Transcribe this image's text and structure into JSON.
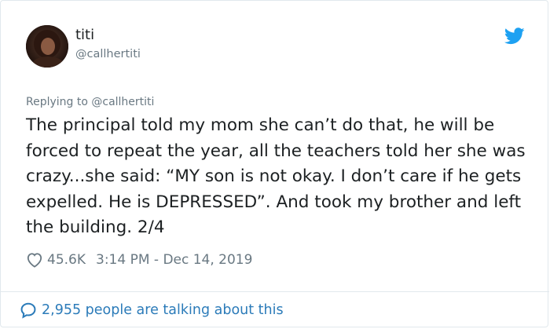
{
  "author": {
    "display_name": "titi",
    "handle": "@callhertiti"
  },
  "reply": {
    "text": "Replying to @callhertiti"
  },
  "tweet": {
    "text": "The principal told my mom she can’t do that, he will be forced to repeat the year, all the teachers told her she was crazy...she said: “MY son is not okay. I don’t care if he gets expelled. He is DEPRESSED”. And took my brother and left the building. 2/4"
  },
  "stats": {
    "likes": "45.6K",
    "timestamp": "3:14 PM - Dec 14, 2019"
  },
  "conversation": {
    "text": "2,955 people are talking about this"
  },
  "icons": {
    "twitter": "twitter-bird-icon",
    "heart": "heart-icon",
    "bubble": "speech-bubble-icon"
  },
  "colors": {
    "link": "#2b7bb9",
    "twitter_blue": "#1da1f2",
    "secondary_text": "#697882",
    "primary_text": "#1c2022",
    "border": "#e1e8ed"
  }
}
